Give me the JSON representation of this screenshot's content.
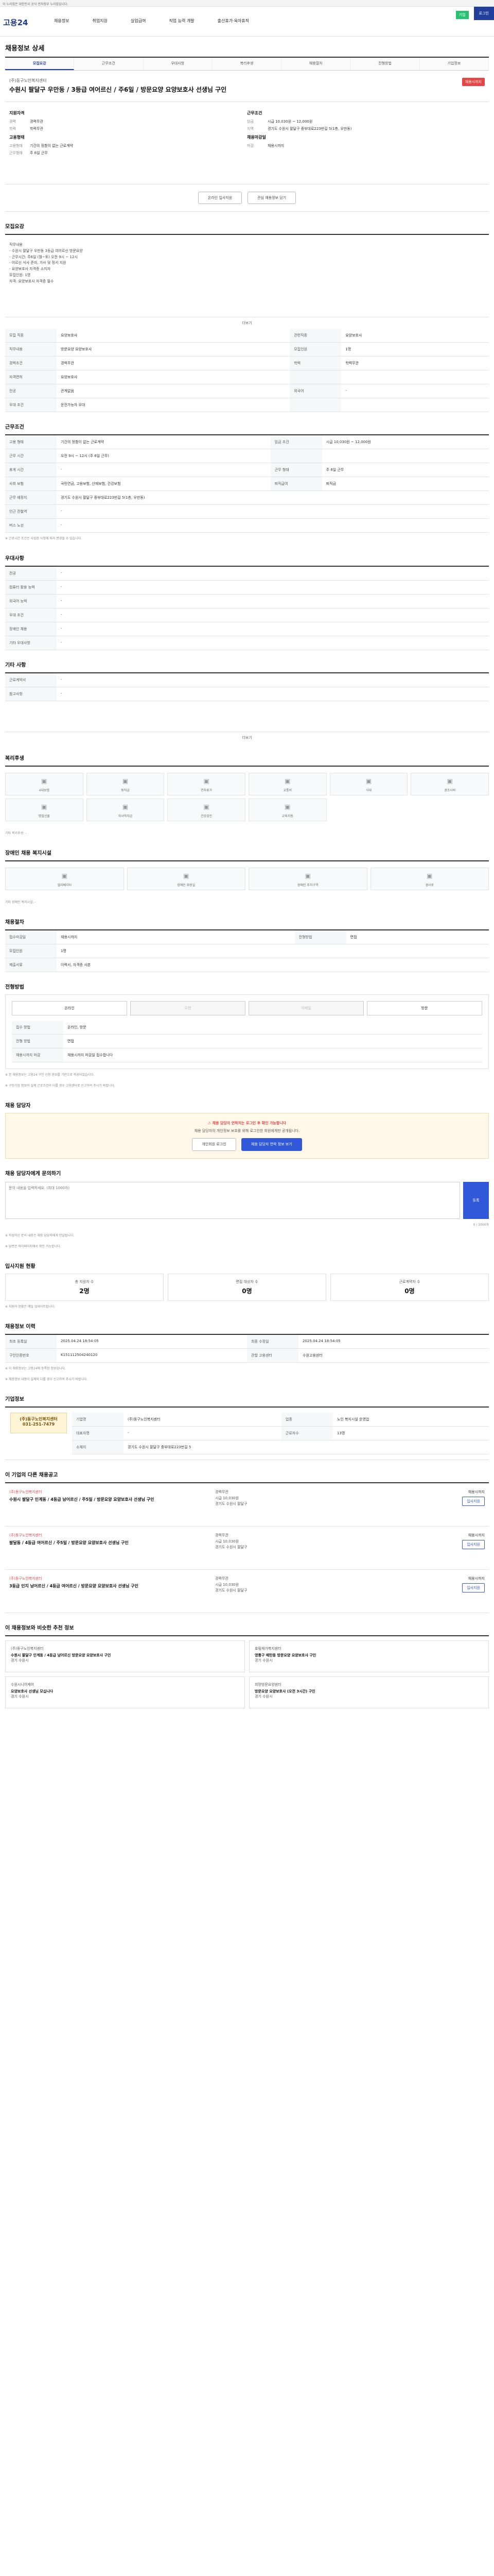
{
  "topbar": {
    "text": "이 누리집은 대한민국 공식 전자정부 누리집입니다."
  },
  "header": {
    "logo": "고용24",
    "nav": [
      "채용정보",
      "취업지원",
      "실업급여",
      "직업 능력 개발",
      "출산휴가·육아휴직"
    ],
    "login": "로그인",
    "badge": "기업"
  },
  "page_title": "채용정보 상세",
  "tabs": [
    "모집요강",
    "근무조건",
    "우대사항",
    "복리후생",
    "채용절차",
    "전형방법",
    "기업정보"
  ],
  "job": {
    "company": "(주)동구노인복지센터",
    "title": "수원시 팔달구 우만동 / 3등급 여어르신 / 주6일 / 방문요양 요양보호사 선생님 구인",
    "deadline": "채용시까지"
  },
  "summary": {
    "left_title": "지원자격",
    "left_rows": [
      {
        "k": "경력",
        "v": "경력무관"
      },
      {
        "k": "학력",
        "v": "학력무관"
      }
    ],
    "left_title2": "고용형태",
    "left_rows2": [
      {
        "k": "고용형태",
        "v": "기간의 정함이 없는 근로계약"
      },
      {
        "k": "근무형태",
        "v": "주 6일 근무"
      }
    ],
    "right_title": "근무조건",
    "right_rows": [
      {
        "k": "임금",
        "v": "시급 10,030원 ~ 12,000원"
      },
      {
        "k": "지역",
        "v": "경기도 수원시 팔달구 중부대로223번길 5(1층, 우만동)"
      }
    ],
    "right_title2": "채용마감일",
    "right_rows2": [
      {
        "k": "마감",
        "v": "채용시까지"
      }
    ]
  },
  "actions": {
    "apply": "온라인 입사지원",
    "scrap": "관심 채용정보 담기"
  },
  "section_recruit": {
    "title": "모집요강",
    "text_lines": [
      "직무내용",
      "- 수원시 팔달구 우만동 3등급 여어르신 방문요양",
      "- 근무시간: 주6일 (월~토) 오전 9시 ~ 12시",
      "- 어르신 식사 준비, 가사 및 정서 지원",
      "- 요양보호사 자격증 소지자",
      "",
      "모집인원: 1명",
      "자격: 요양보호사 자격증 필수"
    ],
    "more": "더보기",
    "rows": [
      {
        "k": "모집 직종",
        "v": "요양보호사",
        "k2": "관련직종",
        "v2": "요양보호사"
      },
      {
        "k": "직무내용",
        "v": "방문요양 요양보호사",
        "k2": "모집인원",
        "v2": "1명"
      },
      {
        "k": "경력조건",
        "v": "경력무관",
        "k2": "학력",
        "v2": "학력무관"
      },
      {
        "k": "자격면허",
        "v": "요양보호사",
        "k2": "",
        "v2": ""
      },
      {
        "k": "전공",
        "v": "관계없음",
        "k2": "외국어",
        "v2": "-"
      },
      {
        "k": "우대 조건",
        "v": "운전가능자 우대",
        "k2": "",
        "v2": ""
      }
    ]
  },
  "section_work": {
    "title": "근무조건",
    "rows": [
      {
        "k": "고용 형태",
        "v": "기간의 정함이 없는 근로계약",
        "k2": "임금 조건",
        "v2": "시급 10,030원 ~ 12,000원"
      },
      {
        "k": "근무 시간",
        "v": "오전 9시 ~ 12시 (주 6일 근무)",
        "k2": "",
        "v2": ""
      },
      {
        "k": "휴게 시간",
        "v": "-",
        "k2": "근무 형태",
        "v2": "주 6일 근무"
      },
      {
        "k": "사회 보험",
        "v": "국민연금, 고용보험, 산재보험, 건강보험",
        "k2": "퇴직급여",
        "v2": "퇴직금"
      },
      {
        "k": "근무 예정지",
        "v": "경기도 수원시 팔달구 중부대로223번길 5(1층, 우만동)",
        "k2": "",
        "v2": ""
      },
      {
        "k": "인근 전철역",
        "v": "-",
        "k2": "",
        "v2": ""
      },
      {
        "k": "버스 노선",
        "v": "-",
        "k2": "",
        "v2": ""
      }
    ],
    "note": "※ 근로시간 조건은 사업장 사정에 따라 변경될 수 있습니다."
  },
  "section_prefer": {
    "title": "우대사항",
    "rows": [
      {
        "k": "전공",
        "v": "-"
      },
      {
        "k": "컴퓨터 활용 능력",
        "v": "-"
      },
      {
        "k": "외국어 능력",
        "v": "-"
      },
      {
        "k": "우대 조건",
        "v": "-"
      },
      {
        "k": "장애인 채용",
        "v": "-"
      },
      {
        "k": "기타 우대사항",
        "v": "-"
      }
    ]
  },
  "section_etc": {
    "title": "기타 사항",
    "rows": [
      {
        "k": "근로계약서",
        "v": "-"
      },
      {
        "k": "참고사항",
        "v": "-"
      }
    ],
    "more": "더보기"
  },
  "section_welfare": {
    "title": "복리후생",
    "items": [
      "4대보험",
      "퇴직금",
      "연차휴가",
      "교통비",
      "식대",
      "경조사비",
      "명절선물",
      "자녀학자금",
      "건강검진",
      "교육지원"
    ],
    "note": "기타 복리후생: -"
  },
  "section_disabled": {
    "title": "장애인 채용 복지시설",
    "items": [
      "엘리베이터",
      "장애인 화장실",
      "장애인 주차구역",
      "경사로"
    ],
    "note": "기타 장애인 복지시설: -"
  },
  "section_process": {
    "title": "채용절차",
    "rows": [
      {
        "k": "접수마감일",
        "v": "채용시까지",
        "k2": "전형방법",
        "v2": "면접"
      },
      {
        "k": "모집인원",
        "v": "1명",
        "k2": "",
        "v2": ""
      },
      {
        "k": "제출서류",
        "v": "이력서, 자격증 사본",
        "k2": "",
        "v2": ""
      }
    ]
  },
  "section_apply": {
    "title": "전형방법",
    "methods": [
      "온라인",
      "우편",
      "이메일",
      "방문"
    ],
    "method_off": [
      false,
      true,
      true,
      false
    ],
    "rows": [
      {
        "k": "접수 방법",
        "v": "온라인, 방문"
      },
      {
        "k": "전형 방법",
        "v": "면접"
      },
      {
        "k": "채용시까지 마감",
        "v": "채용시까지 마감일 접수합니다"
      }
    ],
    "notes": [
      "※ 본 채용정보는 고용24 구인 신청 정보를 기반으로 작성되었습니다.",
      "※ 구인기업 정보와 실제 근로조건이 다를 경우 고용센터로 신고하여 주시기 바랍니다."
    ]
  },
  "section_contact": {
    "title": "채용 담당자",
    "warn": "채용 담당자 연락처는 로그인 후 확인 가능합니다",
    "desc": "채용 담당자의 개인정보 보호를 위해 로그인한 회원에게만 공개됩니다.",
    "btn1": "개인회원 로그인",
    "btn2": "채용 담당자 연락 정보 보기"
  },
  "section_qna": {
    "title": "채용 담당자에게 문의하기",
    "placeholder": "문의 내용을 입력하세요. (최대 1000자)",
    "send": "등록",
    "counter": "0 / 1000자",
    "notes": [
      "※ 작성하신 문의 내용은 채용 담당자에게 전달됩니다.",
      "※ 답변은 마이페이지에서 확인 가능합니다."
    ]
  },
  "section_stats": {
    "title": "입사지원 현황",
    "items": [
      {
        "label": "총 지원자 수",
        "value": "2명"
      },
      {
        "label": "면접 대상자 수",
        "value": "0명"
      },
      {
        "label": "근로계약자 수",
        "value": "0명"
      }
    ],
    "note": "※ 지원자 현황은 매일 업데이트됩니다."
  },
  "section_info": {
    "title": "채용정보 이력",
    "rows": [
      {
        "k": "최초 등록일",
        "v": "2025.04.24 18:54:05",
        "k2": "최종 수정일",
        "v2": "2025.04.24 18:54:05"
      },
      {
        "k": "구인인증번호",
        "v": "K151112504240120",
        "k2": "관할 고용센터",
        "v2": "수원고용센터"
      }
    ],
    "notes": [
      "※ 이 채용정보는 고용24에 등록된 정보입니다.",
      "※ 채용정보 내용이 실제와 다를 경우 신고하여 주시기 바랍니다."
    ]
  },
  "section_company": {
    "title": "기업정보",
    "logo_text": "(주)동구노인복지센터",
    "phone": "031-251-7479",
    "rows": [
      {
        "k": "기업명",
        "v": "(주)동구노인복지센터",
        "k2": "업종",
        "v2": "노인 복지시설 운영업"
      },
      {
        "k": "대표자명",
        "v": "-",
        "k2": "근로자수",
        "v2": "13명"
      },
      {
        "k": "소재지",
        "v": "경기도 수원시 팔달구 중부대로223번길 5",
        "k2": "",
        "v2": ""
      }
    ]
  },
  "section_similar": {
    "title": "이 기업의 다른 채용공고",
    "items": [
      {
        "company": "(주)동구노인복지센터",
        "title": "수원시 팔달구 인계동 / 4등급 남어르신 / 주5일 / 방문요양 요양보호사 선생님 구인",
        "cond1": "경력무관",
        "cond2": "시급 10,030원",
        "loc": "경기도 수원시 팔달구",
        "deadline": "채용시까지"
      },
      {
        "company": "(주)동구노인복지센터",
        "title": "팔달동 / 4등급 여어르신 / 주5일 / 방문요양 요양보호사 선생님 구인",
        "cond1": "경력무관",
        "cond2": "시급 10,030원",
        "loc": "경기도 수원시 팔달구",
        "deadline": "채용시까지"
      },
      {
        "company": "(주)동구노인복지센터",
        "title": "3등급 인지 남어르신 / 4등급 여어르신 / 방문요양 요양보호사 선생님 구인",
        "cond1": "경력무관",
        "cond2": "시급 10,030원",
        "loc": "경기도 수원시 팔달구",
        "deadline": "채용시까지"
      }
    ],
    "btn": "입사지원"
  },
  "section_recommend": {
    "title": "이 채용정보와 비슷한 추천 정보",
    "items": [
      {
        "company": "(주)동구노인복지센터",
        "title": "수원시 팔달구 인계동 / 4등급 남어르신 방문요양 요양보호사 구인",
        "loc": "경기 수원시"
      },
      {
        "company": "효림재가복지센터",
        "title": "영통구 매탄동 방문요양 요양보호사 구인",
        "loc": "경기 수원시"
      },
      {
        "company": "수원시니어케어",
        "title": "요양보호사 선생님 모십니다",
        "loc": "경기 수원시"
      },
      {
        "company": "희망방문요양센터",
        "title": "방문요양 요양보호사 (오전 3시간) 구인",
        "loc": "경기 수원시"
      }
    ]
  }
}
